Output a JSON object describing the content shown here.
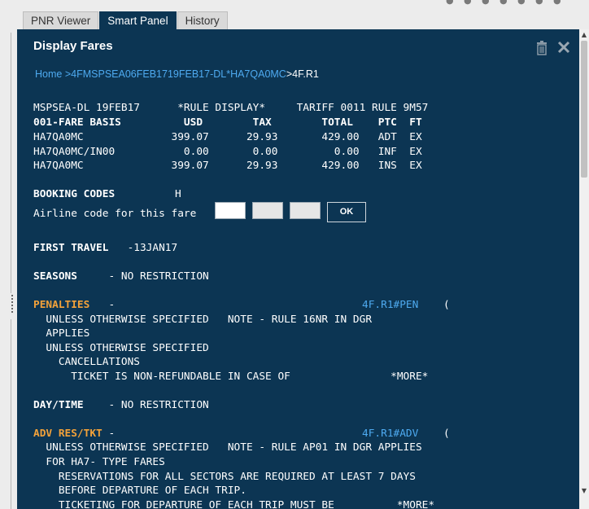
{
  "tabs": [
    {
      "label": "PNR Viewer"
    },
    {
      "label": "Smart Panel"
    },
    {
      "label": "History"
    }
  ],
  "panel": {
    "title": "Display Fares",
    "breadcrumb": {
      "home": "Home",
      "separator": ">",
      "entry": "4FMSPSEA06FEB1719FEB17-DL*HA7QA0MC",
      "current": "4F.R1"
    }
  },
  "fare_header": {
    "line1": "MSPSEA-DL 19FEB17      *RULE DISPLAY*     TARIFF 0011 RULE 9M57",
    "columns": "001-FARE BASIS          USD        TAX        TOTAL    PTC  FT",
    "rows": [
      "HA7QA0MC              399.07      29.93       429.00   ADT  EX",
      "HA7QA0MC/IN00           0.00       0.00         0.00   INF  EX",
      "HA7QA0MC              399.07      29.93       429.00   INS  EX"
    ]
  },
  "booking": {
    "label": "BOOKING CODES",
    "code": "H",
    "airline_prompt": "Airline code for this fare",
    "ok_label": "OK"
  },
  "first_travel": {
    "label": "FIRST TRAVEL",
    "value": "   -13JAN17"
  },
  "seasons": {
    "label": "SEASONS",
    "value": "     - NO RESTRICTION"
  },
  "penalties": {
    "label": "PENALTIES",
    "dash": "   -",
    "link": "4F.R1#PEN",
    "paren": "(",
    "lines": [
      "  UNLESS OTHERWISE SPECIFIED   NOTE - RULE 16NR IN DGR",
      "  APPLIES",
      "  UNLESS OTHERWISE SPECIFIED",
      "    CANCELLATIONS",
      "      TICKET IS NON-REFUNDABLE IN CASE OF                *MORE*"
    ]
  },
  "day_time": {
    "label": "DAY/TIME",
    "value": "    - NO RESTRICTION"
  },
  "adv_res": {
    "label": "ADV RES/TKT",
    "dash": " -",
    "link": "4F.R1#ADV",
    "paren": "(",
    "lines": [
      "  UNLESS OTHERWISE SPECIFIED   NOTE - RULE AP01 IN DGR APPLIES",
      "  FOR HA7- TYPE FARES",
      "    RESERVATIONS FOR ALL SECTORS ARE REQUIRED AT LEAST 7 DAYS",
      "    BEFORE DEPARTURE OF EACH TRIP.",
      "    TICKETING FOR DEPARTURE OF EACH TRIP MUST BE          *MORE*"
    ]
  },
  "colors": {
    "panel_bg": "#0c3553",
    "link": "#4eaaf0",
    "highlight": "#f3a23a"
  }
}
